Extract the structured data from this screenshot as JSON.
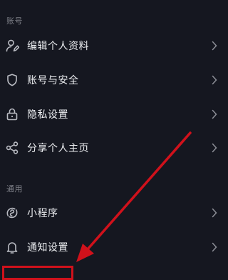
{
  "sections": [
    {
      "header": "账号",
      "items": [
        {
          "label": "编辑个人资料",
          "icon": "user-edit-icon"
        },
        {
          "label": "账号与安全",
          "icon": "shield-icon"
        },
        {
          "label": "隐私设置",
          "icon": "lock-icon"
        },
        {
          "label": "分享个人主页",
          "icon": "share-icon"
        }
      ]
    },
    {
      "header": "通用",
      "items": [
        {
          "label": "小程序",
          "icon": "mini-program-icon"
        },
        {
          "label": "通知设置",
          "icon": "bell-icon"
        }
      ]
    }
  ],
  "colors": {
    "background": "#151720",
    "text": "#eceef1",
    "section_header": "#7d7f87",
    "icon": "#b9bbc2",
    "chevron": "#8d8f97",
    "annotation": "#d0111b"
  }
}
